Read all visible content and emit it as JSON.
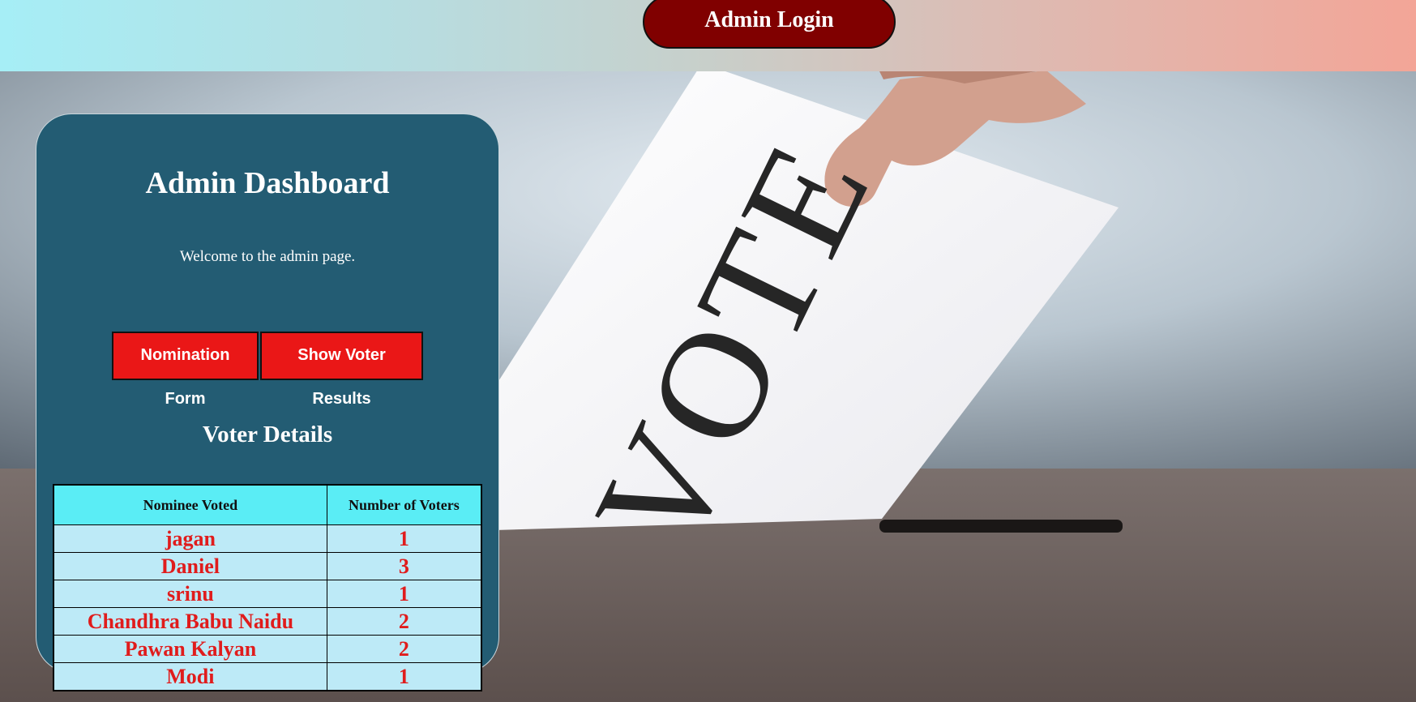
{
  "header": {
    "login_label": "Admin Login"
  },
  "background": {
    "ballot_word": "VOTE"
  },
  "panel": {
    "title": "Admin Dashboard",
    "welcome": "Welcome to the admin page.",
    "buttons": {
      "nomination": "Nomination Form",
      "results": "Show Voter Results"
    },
    "section_title": "Voter Details"
  },
  "table": {
    "headers": [
      "Nominee Voted",
      "Number of Voters"
    ],
    "rows": [
      {
        "nominee": "jagan",
        "count": "1"
      },
      {
        "nominee": "Daniel",
        "count": "3"
      },
      {
        "nominee": "srinu",
        "count": "1"
      },
      {
        "nominee": "Chandhra Babu Naidu",
        "count": "2"
      },
      {
        "nominee": "Pawan Kalyan",
        "count": "2"
      },
      {
        "nominee": "Modi",
        "count": "1"
      }
    ]
  },
  "colors": {
    "panel": "#235c73",
    "button": "#ea1717",
    "login": "#800000",
    "table_header": "#5aedf5",
    "table_cell": "#bdeaf7",
    "table_text": "#e01c1c"
  }
}
